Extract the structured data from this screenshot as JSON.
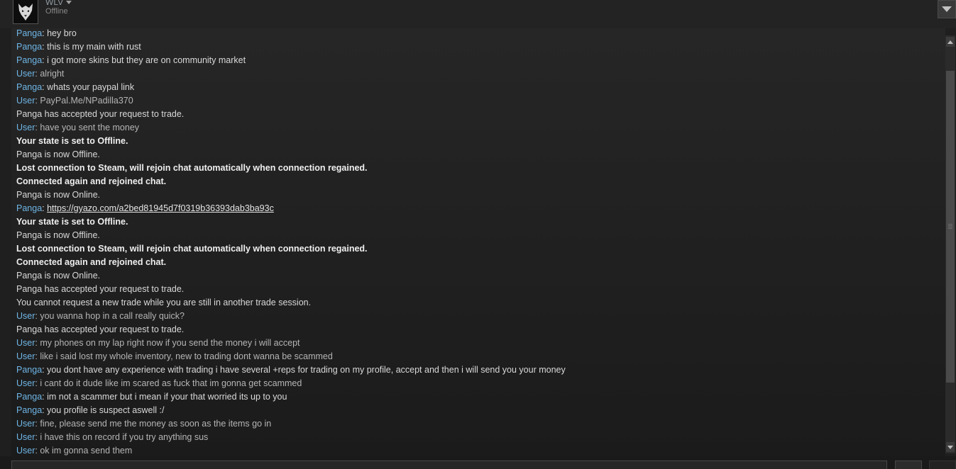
{
  "header": {
    "user_name": "WLV",
    "status": "Offline",
    "avatar_icon": "wolf-avatar-icon",
    "menu_icon": "chevron-down-icon"
  },
  "colors": {
    "sender": "#6fb6e6",
    "text": "#d9d9d9",
    "background": "#1f1f1f"
  },
  "chat": [
    {
      "sender": "Panga",
      "text": "hey bro",
      "type": "panga"
    },
    {
      "sender": "Panga",
      "text": "this is my main with rust",
      "type": "panga"
    },
    {
      "sender": "Panga",
      "text": "i got more skins but they are on community market",
      "type": "panga"
    },
    {
      "sender": "User",
      "text": "alright",
      "type": "user"
    },
    {
      "sender": "Panga",
      "text": "whats your paypal link",
      "type": "panga"
    },
    {
      "sender": "User",
      "text": "PayPal.Me/NPadilla370",
      "type": "user"
    },
    {
      "sender": "",
      "text": "Panga has accepted your request to trade.",
      "type": "sys"
    },
    {
      "sender": "User",
      "text": "have you sent the money",
      "type": "user"
    },
    {
      "sender": "",
      "text": "Your state is set to Offline.",
      "type": "bold"
    },
    {
      "sender": "",
      "text": "Panga is now Offline.",
      "type": "sys"
    },
    {
      "sender": "",
      "text": "Lost connection to Steam, will rejoin chat automatically when connection regained.",
      "type": "bold"
    },
    {
      "sender": "",
      "text": "Connected again and rejoined chat.",
      "type": "bold"
    },
    {
      "sender": "",
      "text": "Panga is now Online.",
      "type": "sys"
    },
    {
      "sender": "Panga",
      "text": "https://gyazo.com/a2bed81945d7f0319b36393dab3ba93c",
      "type": "panga-link"
    },
    {
      "sender": "",
      "text": "Your state is set to Offline.",
      "type": "bold"
    },
    {
      "sender": "",
      "text": "Panga is now Offline.",
      "type": "sys"
    },
    {
      "sender": "",
      "text": "Lost connection to Steam, will rejoin chat automatically when connection regained.",
      "type": "bold"
    },
    {
      "sender": "",
      "text": "Connected again and rejoined chat.",
      "type": "bold"
    },
    {
      "sender": "",
      "text": "Panga is now Online.",
      "type": "sys"
    },
    {
      "sender": "",
      "text": "Panga has accepted your request to trade.",
      "type": "sys"
    },
    {
      "sender": "",
      "text": "You cannot request a new trade while you are still in another trade session.",
      "type": "sys"
    },
    {
      "sender": "User",
      "text": "you wanna hop in a call really quick?",
      "type": "user"
    },
    {
      "sender": "",
      "text": "Panga has accepted your request to trade.",
      "type": "sys"
    },
    {
      "sender": "User",
      "text": "my phones on my lap right now if you send the money i will accept",
      "type": "user"
    },
    {
      "sender": "User",
      "text": "like i said lost my whole inventory, new to trading dont wanna be scammed",
      "type": "user"
    },
    {
      "sender": "Panga",
      "text": "you dont have any experience with trading i have several +reps for trading on my profile, accept and then i will send you your money",
      "type": "panga"
    },
    {
      "sender": "User",
      "text": "i cant do it dude like im scared as fuck that im gonna get scammed",
      "type": "user"
    },
    {
      "sender": "Panga",
      "text": "im not a scammer but i mean if your that worried its up to you",
      "type": "panga"
    },
    {
      "sender": "Panga",
      "text": "you profile is suspect aswell :/",
      "type": "panga"
    },
    {
      "sender": "User",
      "text": "fine, please send me the money as soon as the items go in",
      "type": "user"
    },
    {
      "sender": "User",
      "text": "i have this on record if you try anything sus",
      "type": "user"
    },
    {
      "sender": "User",
      "text": "ok im gonna send them",
      "type": "user"
    }
  ],
  "scrollbar": {
    "up_icon": "arrow-up-icon",
    "down_icon": "arrow-down-icon"
  }
}
